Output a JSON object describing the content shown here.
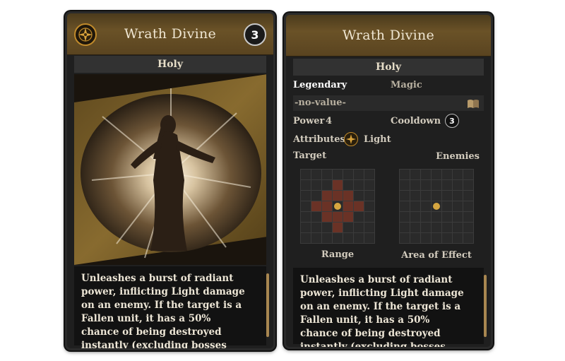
{
  "card": {
    "title": "Wrath Divine",
    "cost": "3",
    "school": "Holy",
    "description": "Unleashes a burst of radiant power, inflicting Light damage on an enemy. If the target is a Fallen unit, it has a 50% chance of being destroyed instantly (excluding bosses and monsters)."
  },
  "details": {
    "rarity": "Legendary",
    "type": "Magic",
    "flavor_value": "-no-value-",
    "power_label": "Power",
    "power_value": "4",
    "cooldown_label": "Cooldown",
    "cooldown_value": "3",
    "attributes_label": "Attributes",
    "attribute_value": "Light",
    "target_label": "Target",
    "target_value": "Enemies",
    "range_label": "Range",
    "aoe_label": "Area of Effect"
  },
  "colors": {
    "accent_gold": "#c08a2b",
    "title_bar": "#5a4420",
    "range_hit": "#6a3226",
    "panel_bg": "#1f1f1f"
  },
  "icons": {
    "emblem": "compass-star-icon",
    "cost_badge": "cooldown-ring-icon",
    "book": "open-book-icon",
    "light": "light-compass-icon"
  }
}
